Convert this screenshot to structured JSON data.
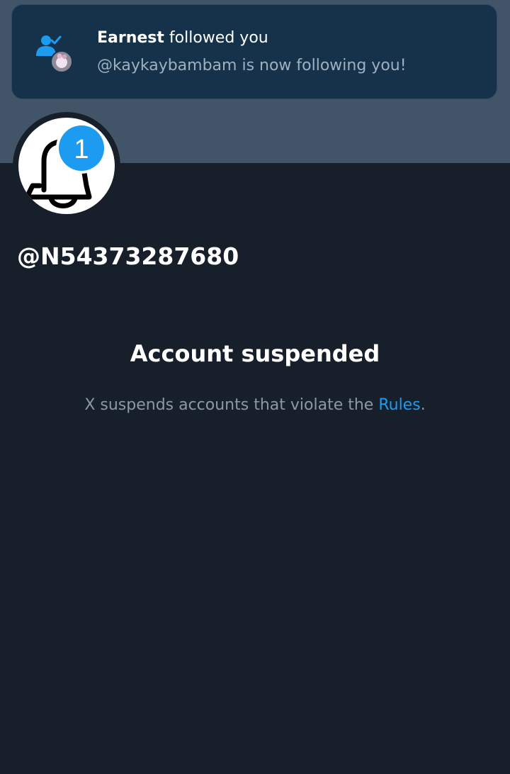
{
  "notification": {
    "icon": "follow-person-check-icon",
    "name": "Earnest",
    "action": "followed you",
    "subtitle": "@kaykaybambam is now following you!"
  },
  "profile": {
    "avatar_icon": "bell-icon",
    "badge_count": "1",
    "handle": "@N54373287680"
  },
  "suspension": {
    "title": "Account suspended",
    "text_prefix": "X suspends accounts that violate the",
    "link": "Rules",
    "text_suffix": "."
  },
  "colors": {
    "background": "#17202a",
    "banner": "#425568",
    "toast": "#16324a",
    "accent": "#1d9bf0",
    "muted_text": "#8b98a5"
  }
}
